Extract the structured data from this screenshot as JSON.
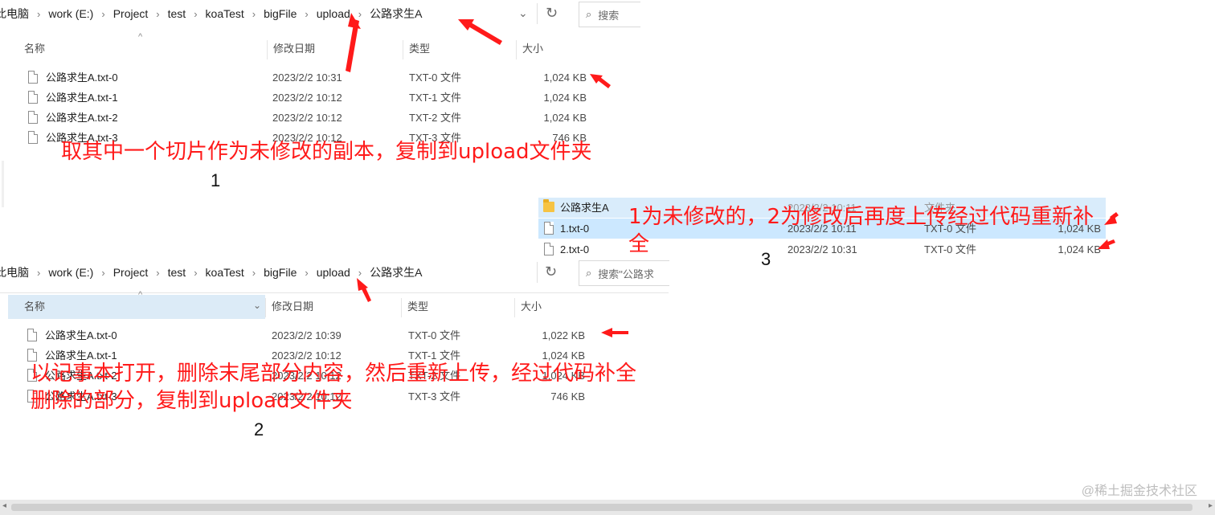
{
  "top_window": {
    "breadcrumb": [
      "此电脑",
      "work (E:)",
      "Project",
      "test",
      "koaTest",
      "bigFile",
      "upload",
      "公路求生A"
    ],
    "search_placeholder": "搜索",
    "refresh_icon": "↻",
    "columns": {
      "name": "名称",
      "date": "修改日期",
      "type": "类型",
      "size": "大小"
    },
    "rows": [
      {
        "name": "公路求生A.txt-0",
        "date": "2023/2/2 10:31",
        "type": "TXT-0 文件",
        "size": "1,024 KB"
      },
      {
        "name": "公路求生A.txt-1",
        "date": "2023/2/2 10:12",
        "type": "TXT-1 文件",
        "size": "1,024 KB"
      },
      {
        "name": "公路求生A.txt-2",
        "date": "2023/2/2 10:12",
        "type": "TXT-2 文件",
        "size": "1,024 KB"
      },
      {
        "name": "公路求生A.txt-3",
        "date": "2023/2/2 10:12",
        "type": "TXT-3 文件",
        "size": "746 KB"
      }
    ]
  },
  "bottom_window": {
    "breadcrumb": [
      "此电脑",
      "work (E:)",
      "Project",
      "test",
      "koaTest",
      "bigFile",
      "upload",
      "公路求生A"
    ],
    "search_placeholder": "搜索\"公路求",
    "refresh_icon": "↻",
    "columns": {
      "name": "名称",
      "date": "修改日期",
      "type": "类型",
      "size": "大小"
    },
    "rows": [
      {
        "name": "公路求生A.txt-0",
        "date": "2023/2/2 10:39",
        "type": "TXT-0 文件",
        "size": "1,022 KB"
      },
      {
        "name": "公路求生A.txt-1",
        "date": "2023/2/2 10:12",
        "type": "TXT-1 文件",
        "size": "1,024 KB"
      },
      {
        "name": "公路求生A.txt-2",
        "date": "2023/2/2 10:12",
        "type": "TXT-2 文件",
        "size": "1,024 KB"
      },
      {
        "name": "公路求生A.txt-3",
        "date": "2023/2/2 10:12",
        "type": "TXT-3 文件",
        "size": "746 KB"
      }
    ]
  },
  "right_window": {
    "folder": {
      "name": "公路求生A",
      "date": "2023/2/2 10:11",
      "type": "文件夹",
      "size": ""
    },
    "rows": [
      {
        "name": "1.txt-0",
        "date": "2023/2/2 10:11",
        "type": "TXT-0 文件",
        "size": "1,024 KB"
      },
      {
        "name": "2.txt-0",
        "date": "2023/2/2 10:31",
        "type": "TXT-0 文件",
        "size": "1,024 KB"
      }
    ]
  },
  "annotations": {
    "note1": "取其中一个切片作为未修改的副本，复制到upload文件夹",
    "note2": "以记事本打开，删除末尾部分内容，然后重新上传，经过代码补全删除的部分，复制到upload文件夹",
    "note3": "1为未修改的，2为修改后再度上传经过代码重新补全",
    "label1": "1",
    "label2": "2",
    "label3": "3"
  },
  "colors": {
    "annotation_red": "#ff1a1a",
    "selection_blue": "#cce8ff",
    "folder_yellow": "#f6c343"
  },
  "watermark": "@稀土掘金技术社区"
}
